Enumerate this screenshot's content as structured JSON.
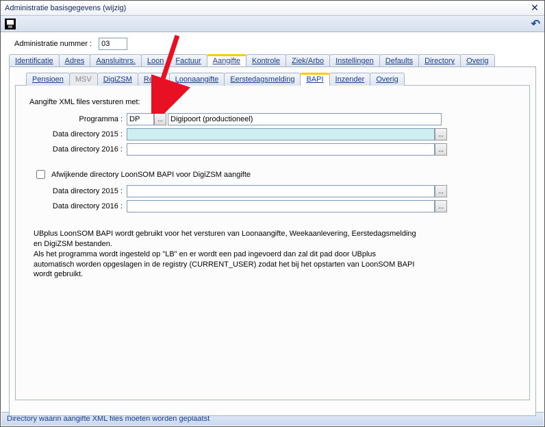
{
  "window": {
    "title": "Administratie basisgegevens  (wijzig)"
  },
  "admin": {
    "label": "Administratie nummer :",
    "value": "03"
  },
  "tabs_main": [
    "Identificatie",
    "Adres",
    "Aansluitnrs.",
    "Loon",
    "Factuur",
    "Aangifte",
    "Kontrole",
    "Ziek/Arbo",
    "Instellingen",
    "Defaults",
    "Directory",
    "Overig"
  ],
  "tabs_main_active": 5,
  "tabs_sub": [
    "Pensioen",
    "MSV",
    "DigiZSM",
    "Retex",
    "Loonaangifte",
    "Eerstedagsmelding",
    "BAPI",
    "Inzender",
    "Overig"
  ],
  "tabs_sub_active": 6,
  "tabs_sub_disabled": 1,
  "section": {
    "heading": "Aangifte XML files versturen met:",
    "programma_label": "Programma :",
    "programma_value": "DP",
    "programma_desc": "Digipoort (productioneel)",
    "dir2015_label": "Data directory 2015 :",
    "dir2015_value": "",
    "dir2016_label": "Data directory 2016 :",
    "dir2016_value": ""
  },
  "afwijk": {
    "checkbox_label": "Afwijkende directory LoonSOM BAPI voor DigiZSM aangifte",
    "dir2015_label": "Data directory 2015 :",
    "dir2015_value": "",
    "dir2016_label": "Data directory 2016 :",
    "dir2016_value": ""
  },
  "info": "UBplus LoonSOM BAPI wordt gebruikt voor het versturen van Loonaangifte, Weekaanlevering, Eerstedagsmelding en DigiZSM bestanden.\nAls het programma wordt ingesteld op \"LB\" en er wordt een pad ingevoerd dan zal dit pad door UBplus automatisch worden opgeslagen in de registry (CURRENT_USER) zodat het bij het opstarten van LoonSOM BAPI wordt gebruikt.",
  "status": "Directory waarin aangifte XML files moeten worden geplaatst",
  "browse_label": "..."
}
